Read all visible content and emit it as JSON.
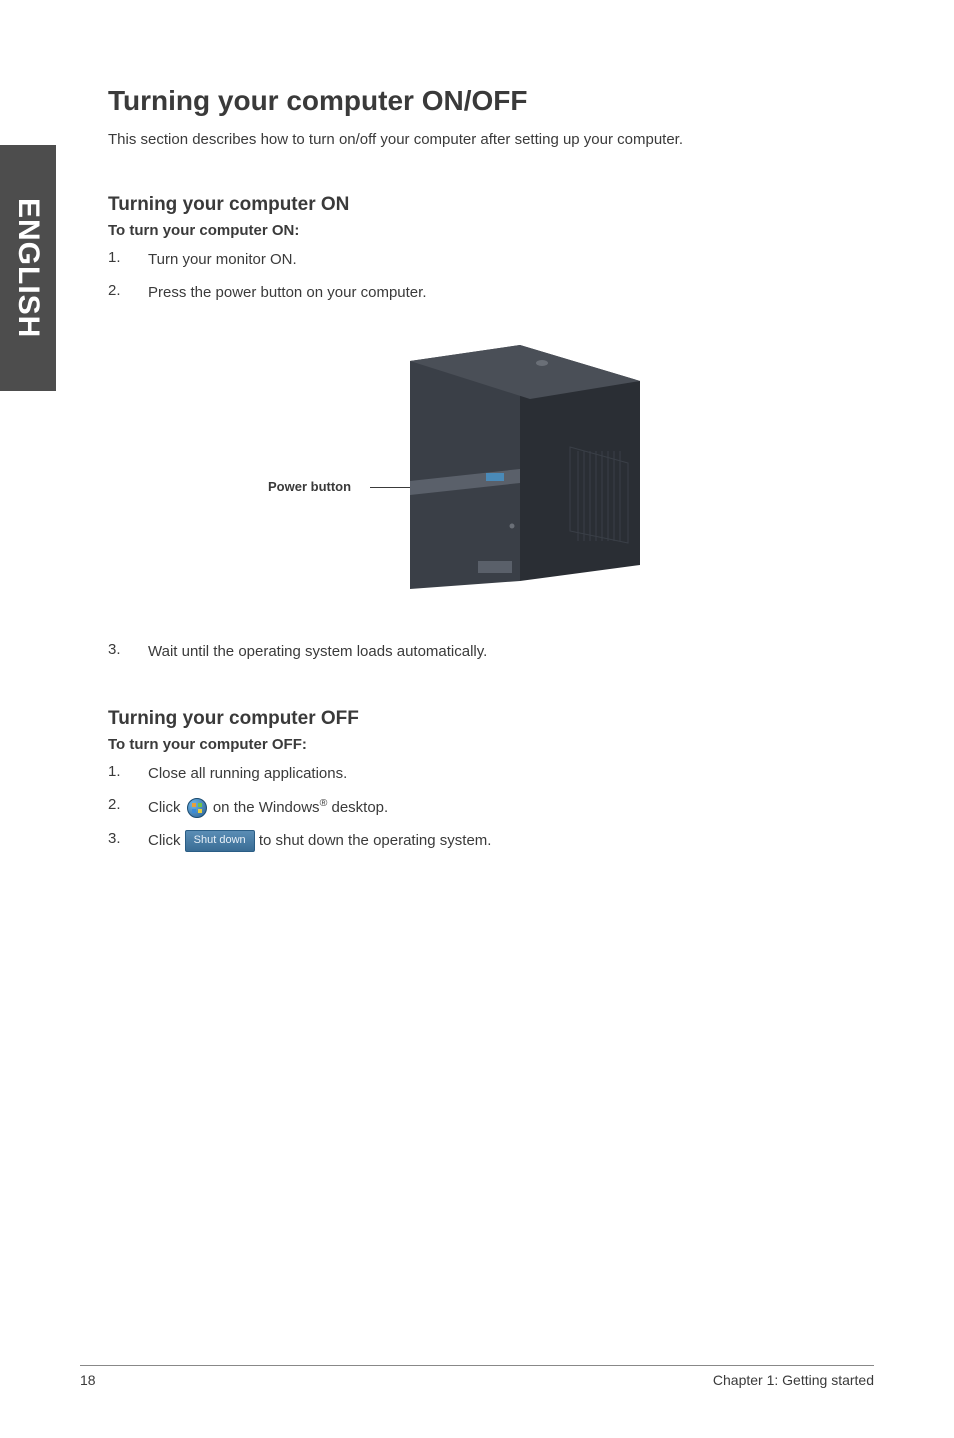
{
  "sidebar": {
    "language": "ENGLISH"
  },
  "heading": "Turning your computer ON/OFF",
  "intro": "This section describes how to turn on/off your computer after setting up your computer.",
  "on": {
    "heading": "Turning your computer ON",
    "sub": "To turn your computer ON:",
    "step1": "Turn your monitor ON.",
    "step2": "Press the power button on your computer.",
    "label": "Power button",
    "step3": "Wait until the operating system loads automatically."
  },
  "off": {
    "heading": "Turning your computer OFF",
    "sub": "To turn your computer OFF:",
    "step1": "Close all running applications.",
    "step2a": "Click ",
    "step2b": " on the Windows",
    "step2c": " desktop.",
    "reg": "®",
    "step3a": "Click ",
    "shutdown_label": "Shut down",
    "step3b": " to shut down the operating system."
  },
  "nums": {
    "n1": "1.",
    "n2": "2.",
    "n3": "3."
  },
  "footer": {
    "page": "18",
    "chapter": "Chapter 1: Getting started"
  }
}
